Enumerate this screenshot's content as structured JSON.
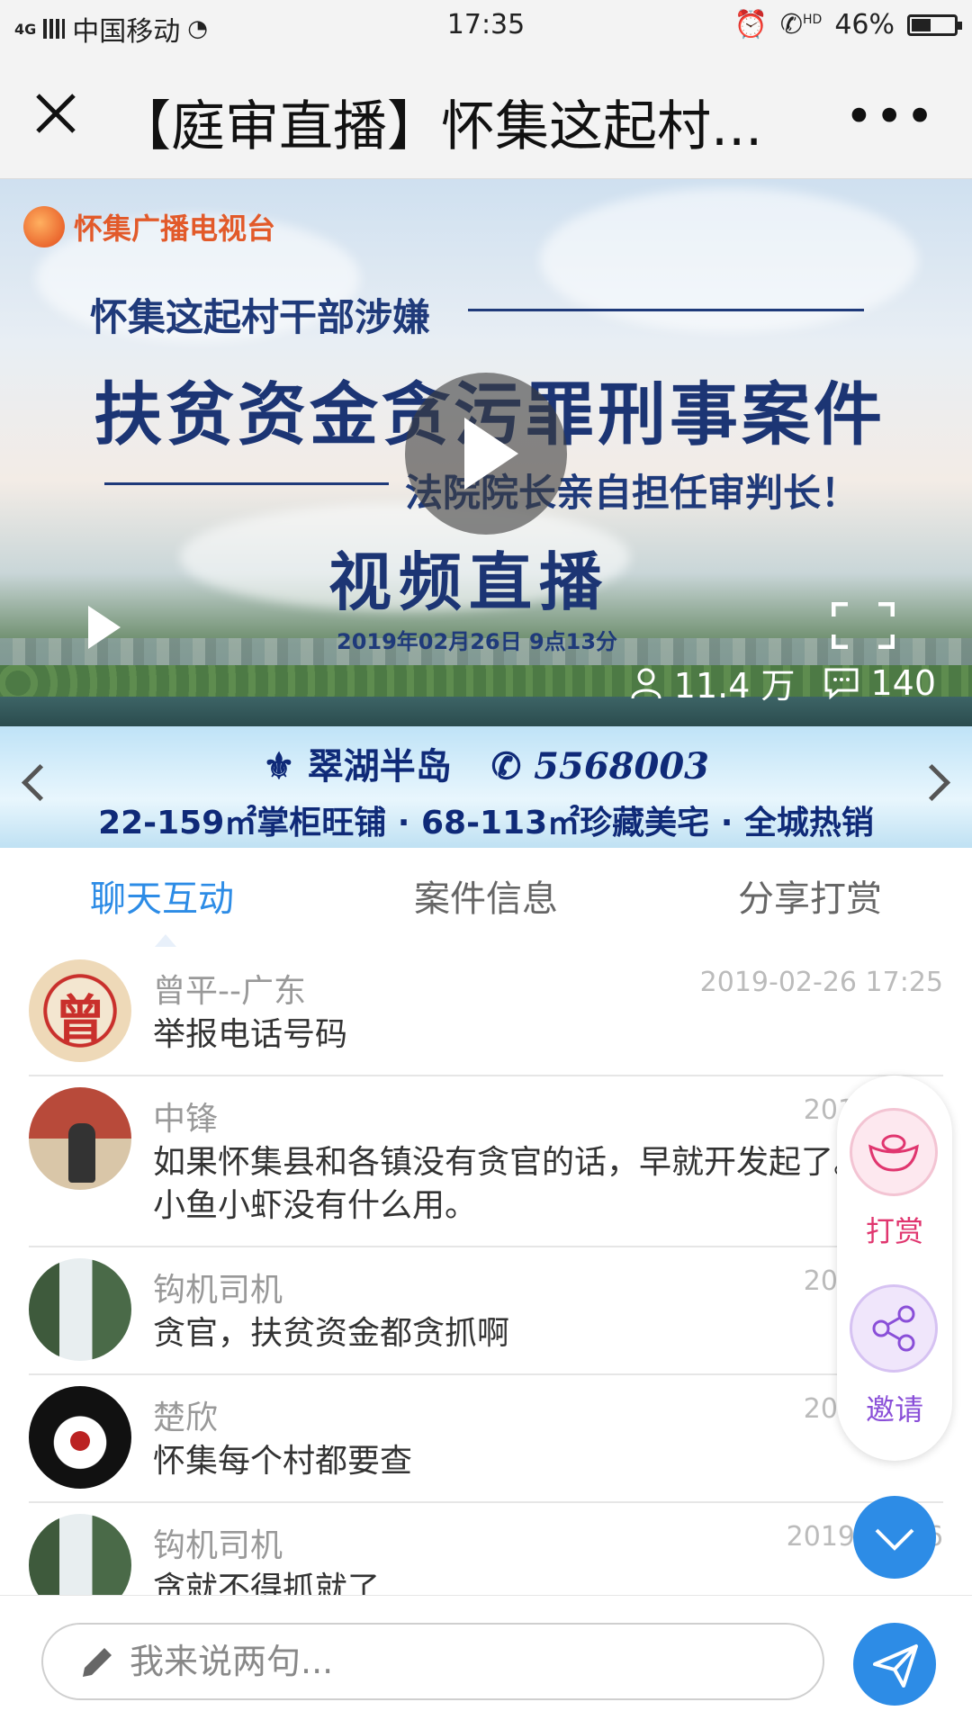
{
  "status_bar": {
    "network": "4G",
    "carrier": "中国移动",
    "time": "17:35",
    "hd": "HD",
    "battery": "46%",
    "battery_level": 0.46
  },
  "title_bar": {
    "title": "【庭审直播】怀集这起村..."
  },
  "video": {
    "station": "怀集广播电视台",
    "headline_1": "怀集这起村干部涉嫌",
    "headline_2": "扶贫资金贪污罪刑事案件",
    "headline_3": "法院院长亲自担任审判长！",
    "headline_4": "视频直播",
    "datetime": "2019年02月26日  9点13分",
    "views": "11.4 万",
    "comments": "140"
  },
  "banner": {
    "brand": "翠湖半岛",
    "phone": "5568003",
    "tagline": "22-159㎡掌柜旺铺 · 68-113㎡珍藏美宅 · 全城热销"
  },
  "tabs": [
    {
      "label": "聊天互动"
    },
    {
      "label": "案件信息"
    },
    {
      "label": "分享打赏"
    }
  ],
  "messages": [
    {
      "name": "曾平--广东",
      "time": "2019-02-26 17:25",
      "text": "举报电话号码"
    },
    {
      "name": "中锋",
      "time": "2019-02-2",
      "text": "如果怀集县和各镇没有贪官的话，早就开发起了。只抓小鱼小虾没有什么用。"
    },
    {
      "name": "钩机司机",
      "time": "2019-02-2",
      "text": "贪官，扶贫资金都贪抓啊"
    },
    {
      "name": "楚欣",
      "time": "2019-02-2",
      "text": "怀集每个村都要查"
    },
    {
      "name": "钩机司机",
      "time": "2019-02-26",
      "text": "贪就不得抓就了"
    }
  ],
  "floating": {
    "reward_label": "打赏",
    "invite_label": "邀请"
  },
  "input": {
    "placeholder": "我来说两句..."
  },
  "colors": {
    "accent": "#2d8ce6",
    "reward": "#e0366f",
    "invite": "#8a4fd8"
  }
}
